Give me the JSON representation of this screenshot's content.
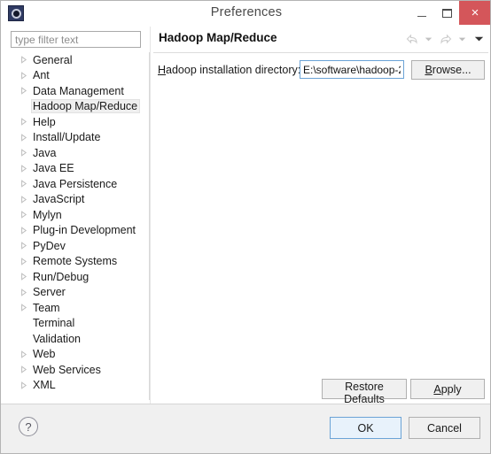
{
  "window": {
    "title": "Preferences",
    "icon": "eclipse-app-icon",
    "controls": {
      "minimize": "–",
      "maximize": "□",
      "close": "×"
    },
    "close_color": "#d4565a"
  },
  "sidebar": {
    "filter": {
      "placeholder": "type filter text",
      "value": ""
    },
    "items": [
      {
        "label": "General",
        "expandable": true,
        "selected": false
      },
      {
        "label": "Ant",
        "expandable": true,
        "selected": false
      },
      {
        "label": "Data Management",
        "expandable": true,
        "selected": false
      },
      {
        "label": "Hadoop Map/Reduce",
        "expandable": false,
        "selected": true
      },
      {
        "label": "Help",
        "expandable": true,
        "selected": false
      },
      {
        "label": "Install/Update",
        "expandable": true,
        "selected": false
      },
      {
        "label": "Java",
        "expandable": true,
        "selected": false
      },
      {
        "label": "Java EE",
        "expandable": true,
        "selected": false
      },
      {
        "label": "Java Persistence",
        "expandable": true,
        "selected": false
      },
      {
        "label": "JavaScript",
        "expandable": true,
        "selected": false
      },
      {
        "label": "Mylyn",
        "expandable": true,
        "selected": false
      },
      {
        "label": "Plug-in Development",
        "expandable": true,
        "selected": false
      },
      {
        "label": "PyDev",
        "expandable": true,
        "selected": false
      },
      {
        "label": "Remote Systems",
        "expandable": true,
        "selected": false
      },
      {
        "label": "Run/Debug",
        "expandable": true,
        "selected": false
      },
      {
        "label": "Server",
        "expandable": true,
        "selected": false
      },
      {
        "label": "Team",
        "expandable": true,
        "selected": false
      },
      {
        "label": "Terminal",
        "expandable": false,
        "selected": false
      },
      {
        "label": "Validation",
        "expandable": false,
        "selected": false
      },
      {
        "label": "Web",
        "expandable": true,
        "selected": false
      },
      {
        "label": "Web Services",
        "expandable": true,
        "selected": false
      },
      {
        "label": "XML",
        "expandable": true,
        "selected": false
      }
    ]
  },
  "detail": {
    "title": "Hadoop Map/Reduce",
    "nav": {
      "back_icon": "back-arrow-icon",
      "back_menu_icon": "chevron-down-icon",
      "forward_icon": "forward-arrow-icon",
      "forward_menu_icon": "chevron-down-icon",
      "view_menu_icon": "chevron-down-icon"
    },
    "field": {
      "label_mnemonic": "H",
      "label_rest": "adoop installation directory:",
      "value": "E:\\software\\hadoop-2",
      "focused": true
    },
    "browse_button": {
      "mnemonic": "B",
      "rest": "rowse..."
    },
    "restore_defaults_button": {
      "pre": "Restore ",
      "mnemonic": "D",
      "rest": "efaults"
    },
    "apply_button": {
      "mnemonic": "A",
      "rest": "pply"
    }
  },
  "footer": {
    "help_icon": "question-mark-icon",
    "help_glyph": "?",
    "ok_label": "OK",
    "cancel_label": "Cancel",
    "default_button": "OK",
    "focus_color": "#6ba3d6"
  }
}
